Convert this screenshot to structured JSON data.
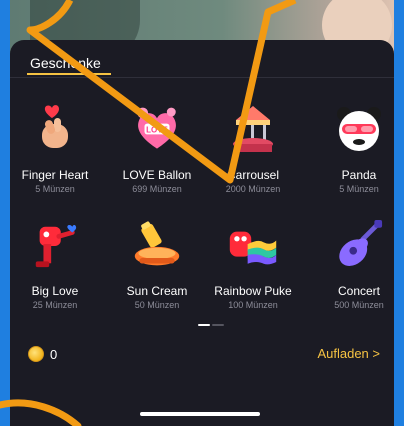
{
  "tab": {
    "title": "Geschenke"
  },
  "gifts": [
    {
      "name": "Finger Heart",
      "price": "5 Münzen",
      "icon": "finger-heart-icon"
    },
    {
      "name": "LOVE Ballon",
      "price": "699 Münzen",
      "icon": "love-balloon-icon",
      "badge": "LOVE"
    },
    {
      "name": "Carrousel",
      "price": "2000 Münzen",
      "icon": "carousel-icon"
    },
    {
      "name": "Panda",
      "price": "5 Münzen",
      "icon": "panda-icon"
    },
    {
      "name": "Big Love",
      "price": "25 Münzen",
      "icon": "big-love-icon"
    },
    {
      "name": "Sun Cream",
      "price": "50 Münzen",
      "icon": "sun-cream-icon"
    },
    {
      "name": "Rainbow Puke",
      "price": "100 Münzen",
      "icon": "rainbow-puke-icon"
    },
    {
      "name": "Concert",
      "price": "500 Münzen",
      "icon": "guitar-icon"
    }
  ],
  "footer": {
    "balance": "0",
    "recharge_label": "Aufladen >"
  },
  "colors": {
    "accent": "#f6c343",
    "sheet": "#1b1b24",
    "bubble": "#f29a13",
    "frame": "#1f7fe0"
  }
}
